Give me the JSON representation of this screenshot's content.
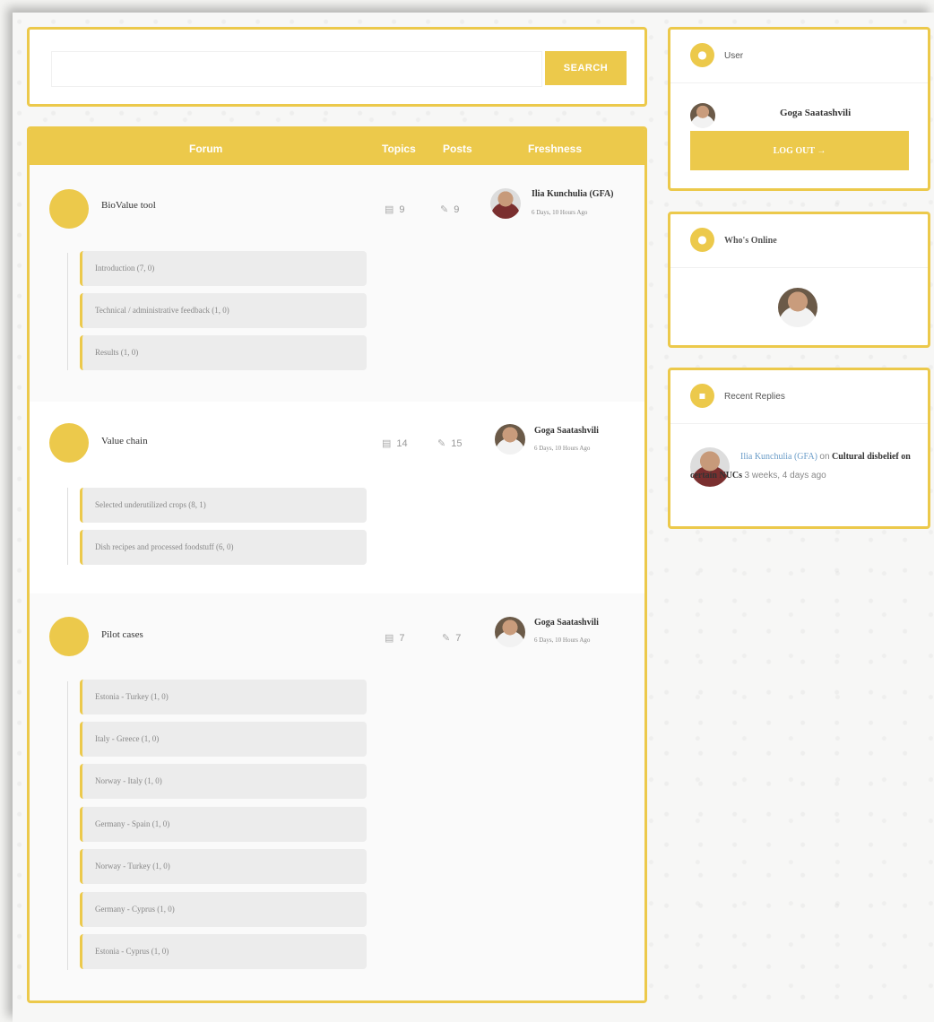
{
  "search": {
    "placeholder": "",
    "button_label": "SEARCH"
  },
  "forum_table": {
    "columns": {
      "forum": "Forum",
      "topics": "Topics",
      "posts": "Posts",
      "freshness": "Freshness"
    },
    "forums": [
      {
        "title": "BioValue tool",
        "topics": "9",
        "posts": "9",
        "fresh_author": "Ilia Kunchulia (GFA)",
        "fresh_time": "6 Days, 10 Hours Ago",
        "subforums": [
          "Introduction (7, 0)",
          "Technical / administrative feedback (1, 0)",
          "Results (1, 0)"
        ]
      },
      {
        "title": "Value chain",
        "topics": "14",
        "posts": "15",
        "fresh_author": "Goga Saatashvili",
        "fresh_time": "6 Days, 10 Hours Ago",
        "subforums": [
          "Selected underutilized crops (8, 1)",
          "Dish recipes and processed foodstuff (6, 0)"
        ]
      },
      {
        "title": "Pilot cases",
        "topics": "7",
        "posts": "7",
        "fresh_author": "Goga Saatashvili",
        "fresh_time": "6 Days, 10 Hours Ago",
        "subforums": [
          "Estonia - Turkey (1, 0)",
          "Italy - Greece (1, 0)",
          "Norway - Italy (1, 0)",
          "Germany - Spain (1, 0)",
          "Norway - Turkey (1, 0)",
          "Germany - Cyprus (1, 0)",
          "Estonia - Cyprus (1, 0)"
        ]
      }
    ]
  },
  "user_widget": {
    "title": "User",
    "icon": "user-icon",
    "name": "Goga Saatashvili",
    "logout_label": "LOG OUT →"
  },
  "online_widget": {
    "title": "Who's Online",
    "icon": "location-pin-icon"
  },
  "replies_widget": {
    "title": "Recent Replies",
    "icon": "chat-bubble-icon",
    "reply": {
      "author": "Ilia Kunchulia (GFA)",
      "on": "on",
      "topic": "Cultural disbelief on certain NUCs",
      "time": "3 weeks, 4 days ago"
    }
  },
  "colors": {
    "accent": "#ecc94b",
    "link": "#6a9cc8"
  }
}
